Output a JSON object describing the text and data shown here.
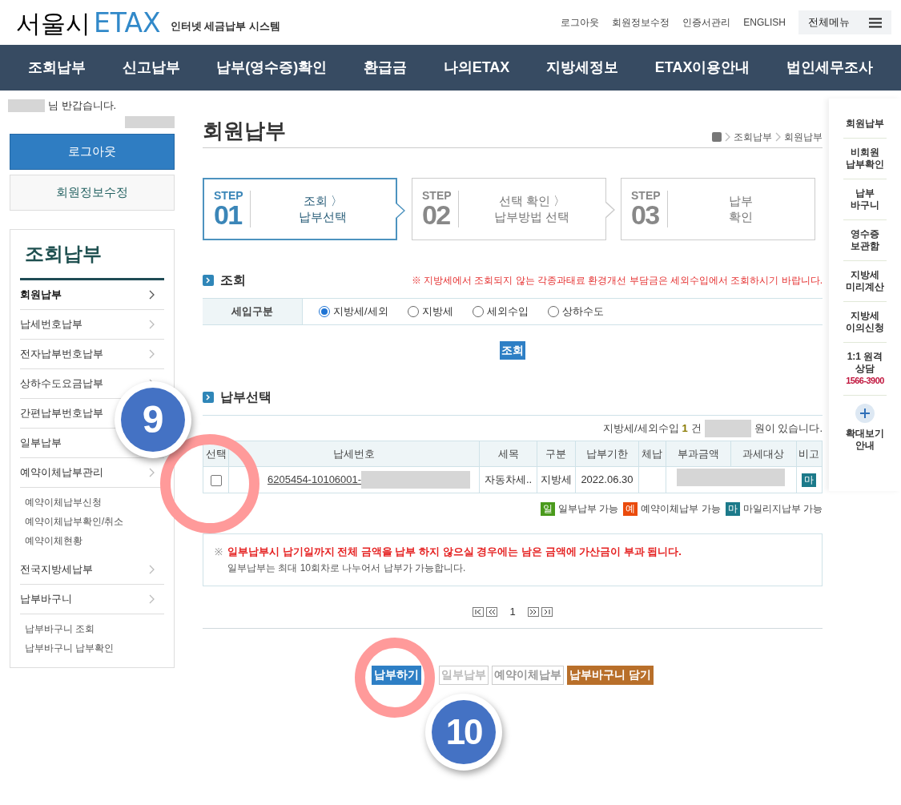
{
  "header": {
    "logo": {
      "city": "서울시",
      "brand": "ETAX",
      "tagline": "인터넷 세금납부 시스템"
    },
    "top_links": [
      "로그아웃",
      "회원정보수정",
      "인증서관리",
      "ENGLISH"
    ],
    "all_menu": "전체메뉴"
  },
  "nav": [
    "조회납부",
    "신고납부",
    "납부(영수증)확인",
    "환급금",
    "나의ETAX",
    "지방세정보",
    "ETAX이용안내",
    "법인세무조사"
  ],
  "sidebar": {
    "greeting": "님 반갑습니다.",
    "logout": "로그아웃",
    "edit_profile": "회원정보수정",
    "section_title": "조회납부",
    "items": [
      {
        "label": "회원납부",
        "kind": "main",
        "selected": true
      },
      {
        "label": "납세번호납부",
        "kind": "main",
        "selected": false
      },
      {
        "label": "전자납부번호납부",
        "kind": "main",
        "selected": false
      },
      {
        "label": "상하수도요금납부",
        "kind": "main",
        "selected": false
      },
      {
        "label": "간편납부번호납부",
        "kind": "main",
        "selected": false
      },
      {
        "label": "일부납부",
        "kind": "main",
        "selected": false
      },
      {
        "label": "예약이체납부관리",
        "kind": "main",
        "selected": false,
        "children": [
          {
            "label": "예약이체납부신청"
          },
          {
            "label": "예약이체납부확인/취소"
          },
          {
            "label": "예약이체현황"
          }
        ]
      },
      {
        "label": "전국지방세납부",
        "kind": "main",
        "selected": false
      },
      {
        "label": "납부바구니",
        "kind": "main",
        "selected": false,
        "children": [
          {
            "label": "납부바구니 조회"
          },
          {
            "label": "납부바구니 납부확인"
          }
        ]
      }
    ]
  },
  "page": {
    "title": "회원납부",
    "breadcrumb": [
      "조회납부",
      "회원납부"
    ],
    "steps": [
      {
        "step": "STEP",
        "number": "01",
        "lines": [
          "조회 〉",
          "납부선택"
        ],
        "selected": true
      },
      {
        "step": "STEP",
        "number": "02",
        "lines": [
          "선택 확인 〉",
          "납부방법 선택"
        ],
        "selected": false
      },
      {
        "step": "STEP",
        "number": "03",
        "lines": [
          "납부",
          "확인"
        ],
        "selected": false
      }
    ],
    "inquiry": {
      "title": "조회",
      "notice": "※ 지방세에서 조회되지 않는 각종과태료 환경개선 부담금은 세외수입에서 조회하시기 바랍니다.",
      "field_label": "세입구분",
      "options": [
        {
          "label": "지방세/세외",
          "selected": true
        },
        {
          "label": "지방세",
          "selected": false
        },
        {
          "label": "세외수입",
          "selected": false
        },
        {
          "label": "상하수도",
          "selected": false
        }
      ],
      "button": "조회"
    },
    "selection": {
      "title": "납부선택",
      "summary": {
        "prefix": "지방세/세외수입",
        "count": "1",
        "unit": "건",
        "suffix": "원이 있습니다."
      },
      "columns": [
        "선택",
        "납세번호",
        "세목",
        "구분",
        "납부기한",
        "체납",
        "부과금액",
        "과세대상",
        "비고"
      ],
      "rows": [
        {
          "checked": false,
          "number": "6205454-10106001-",
          "tax_item": "자동차세..",
          "category": "지방세",
          "due": "2022.06.30",
          "badge": "마",
          "color": "#1c7a8a"
        }
      ],
      "legend": [
        {
          "tag": "일",
          "label": "일부납부 가능",
          "color": "#4a9a1c"
        },
        {
          "tag": "예",
          "label": "예약이체납부 가능",
          "color": "#ea4b0c"
        },
        {
          "tag": "마",
          "label": "마일리지납부 가능",
          "color": "#1c7a8a"
        }
      ],
      "note": {
        "mark": "※",
        "warning": "일부납부시 납기일까지 전체 금액을 납부 하지 않으실 경우에는 남은 금액에 가산금이 부과 됩니다.",
        "info": "일부납부는 최대 10회차로 나누어서 납부가 가능합니다."
      },
      "page_number": "1"
    },
    "actions": [
      {
        "label": "납부하기",
        "kind": "primary"
      },
      {
        "label": "일부납부",
        "kind": "disabled"
      },
      {
        "label": "예약이체납부",
        "kind": "outline"
      },
      {
        "label": "납부바구니 담기",
        "kind": "accent"
      }
    ]
  },
  "right_rail": [
    {
      "lines": [
        "회원납부"
      ]
    },
    {
      "lines": [
        "비회원",
        "납부확인"
      ]
    },
    {
      "lines": [
        "납부",
        "바구니"
      ]
    },
    {
      "lines": [
        "영수증",
        "보관함"
      ]
    },
    {
      "lines": [
        "지방세",
        "미리계산"
      ]
    },
    {
      "lines": [
        "지방세",
        "이의신청"
      ]
    },
    {
      "lines": [
        "1:1 원격",
        "상담"
      ],
      "phone": "1566-3900"
    },
    {
      "lines": [
        "확대보기",
        "안내"
      ],
      "kind": "zoom"
    }
  ],
  "annotations": [
    {
      "label": "9"
    },
    {
      "label": "10"
    }
  ]
}
